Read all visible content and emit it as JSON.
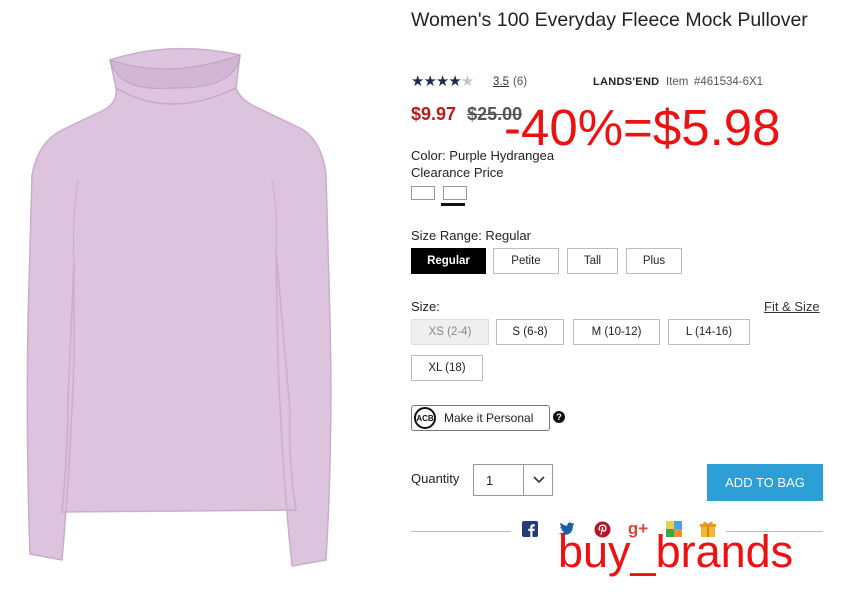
{
  "product": {
    "title": "Women's 100 Everyday Fleece Mock Pullover",
    "rating_value": "3.5",
    "review_count": "(6)",
    "stars_filled": "★★★★",
    "stars_empty": "★",
    "rating": 3.5,
    "brand": "LANDS'END",
    "item_label": "Item",
    "item_number": "#461534-6X1",
    "sale_price": "$9.97",
    "original_price": "$25.00",
    "color_line": "Color: Purple Hydrangea",
    "clearance_label": "Clearance Price",
    "image_color": "#dcc3de"
  },
  "size_range": {
    "label": "Size Range: Regular",
    "options": [
      "Regular",
      "Petite",
      "Tall",
      "Plus"
    ],
    "selected": "Regular"
  },
  "size": {
    "label": "Size:",
    "fit_link": "Fit & Size",
    "options": [
      "XS (2-4)",
      "S (6-8)",
      "M (10-12)",
      "L (14-16)",
      "XL (18)"
    ],
    "unavailable": "XS (2-4)"
  },
  "personalize": {
    "icon_text": "ACB",
    "label": "Make it Personal",
    "help": "?"
  },
  "quantity": {
    "label": "Quantity",
    "value": "1"
  },
  "cart": {
    "add_label": "ADD TO BAG",
    "button_color": "#2b9fd6"
  },
  "social": {
    "icons": [
      "facebook-icon",
      "twitter-icon",
      "pinterest-icon",
      "google-plus-icon",
      "delicious-icon",
      "gift-icon"
    ],
    "gplus_text": "g+"
  },
  "overlays": {
    "discount": "-40%=$5.98",
    "watermark": "buy_brands",
    "color": "#ee1111"
  },
  "colors": {
    "sale_price": "#b71c1c",
    "stars": "#1d2d4c"
  }
}
